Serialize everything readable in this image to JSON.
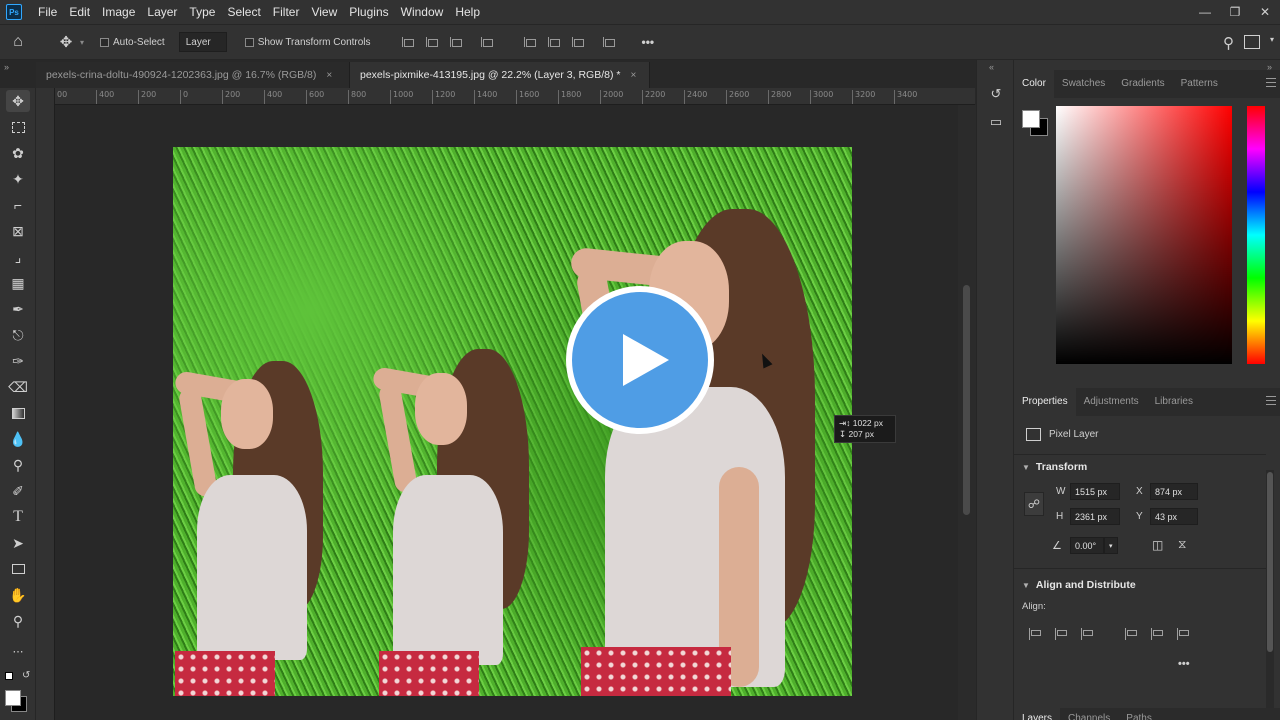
{
  "app": {
    "logo": "Ps"
  },
  "menu": [
    "File",
    "Edit",
    "Image",
    "Layer",
    "Type",
    "Select",
    "Filter",
    "View",
    "Plugins",
    "Window",
    "Help"
  ],
  "options": {
    "auto_select_label": "Auto-Select",
    "auto_select_target": "Layer",
    "show_transform_label": "Show Transform Controls",
    "more": "•••"
  },
  "documents": [
    {
      "title": "pexels-crina-doltu-490924-1202363.jpg @ 16.7% (RGB/8)",
      "close": "×"
    },
    {
      "title": "pexels-pixmike-413195.jpg @ 22.2% (Layer 3, RGB/8) *",
      "close": "×"
    }
  ],
  "ruler_h": [
    "00",
    "400",
    "200",
    "0",
    "200",
    "400",
    "600",
    "800",
    "1000",
    "1200",
    "1400",
    "1600",
    "1800",
    "2000",
    "2200",
    "2400",
    "2600",
    "2800",
    "3000",
    "3200",
    "3400"
  ],
  "tooltip": {
    "width": "1022 px",
    "height": "207 px"
  },
  "panels": {
    "color_tabs": [
      "Color",
      "Swatches",
      "Gradients",
      "Patterns"
    ],
    "props_tabs": [
      "Properties",
      "Adjustments",
      "Libraries"
    ],
    "layer_type": "Pixel Layer",
    "transform_title": "Transform",
    "w_label": "W",
    "w_value": "1515 px",
    "h_label": "H",
    "h_value": "2361 px",
    "x_label": "X",
    "x_value": "874 px",
    "y_label": "Y",
    "y_value": "43 px",
    "angle_value": "0.00°",
    "align_title": "Align and Distribute",
    "align_label": "Align:",
    "more": "•••",
    "layers_tabs": [
      "Layers",
      "Channels",
      "Paths"
    ]
  },
  "colors": {
    "foreground": "#ffffff",
    "background": "#000000",
    "play": "#4f9de5"
  }
}
